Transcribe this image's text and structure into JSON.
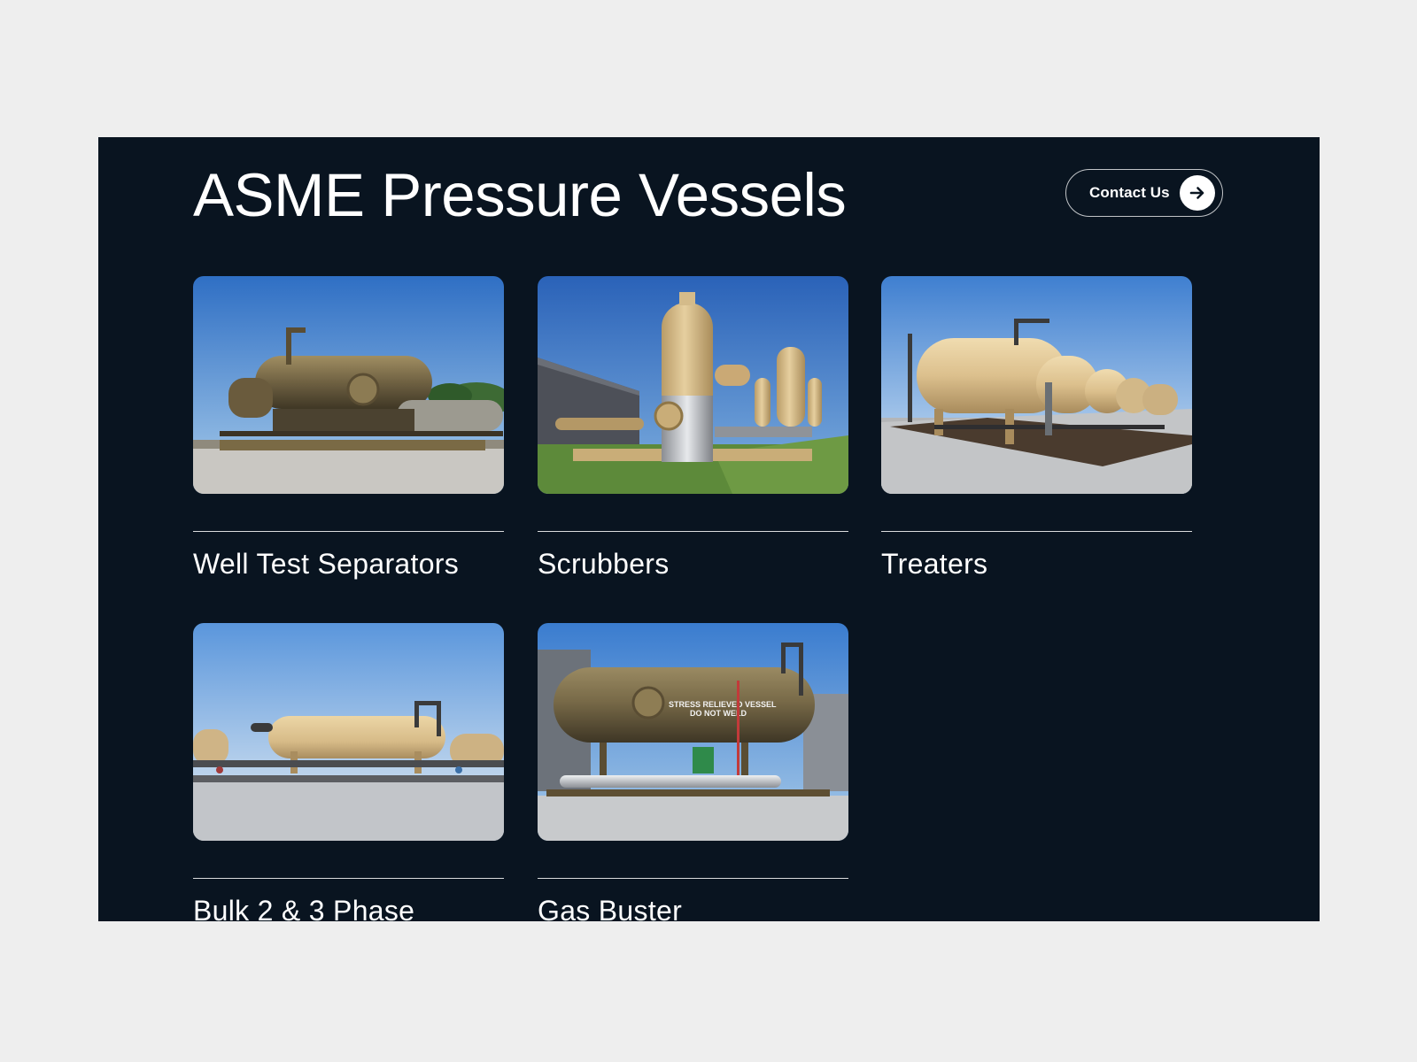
{
  "page": {
    "title": "ASME Pressure Vessels"
  },
  "header": {
    "contact_label": "Contact Us",
    "contact_icon": "arrow-right-icon"
  },
  "products": [
    {
      "label": "Well Test Separators",
      "image": "well-test-separators-photo"
    },
    {
      "label": "Scrubbers",
      "image": "scrubbers-photo"
    },
    {
      "label": "Treaters",
      "image": "treaters-photo"
    },
    {
      "label": "Bulk 2 & 3 Phase",
      "image": "bulk-2-3-phase-photo"
    },
    {
      "label": "Gas Buster",
      "image": "gas-buster-photo"
    }
  ],
  "gas_buster_stencil": "STRESS RELIEVED VESSEL DO NOT WELD",
  "colors": {
    "panel_background": "#091420",
    "page_background": "#eeeeee",
    "text": "#ffffff",
    "vessel_tan": "#d8bc8a",
    "vessel_olive": "#7a6a45",
    "sky": "#4a86cf"
  }
}
